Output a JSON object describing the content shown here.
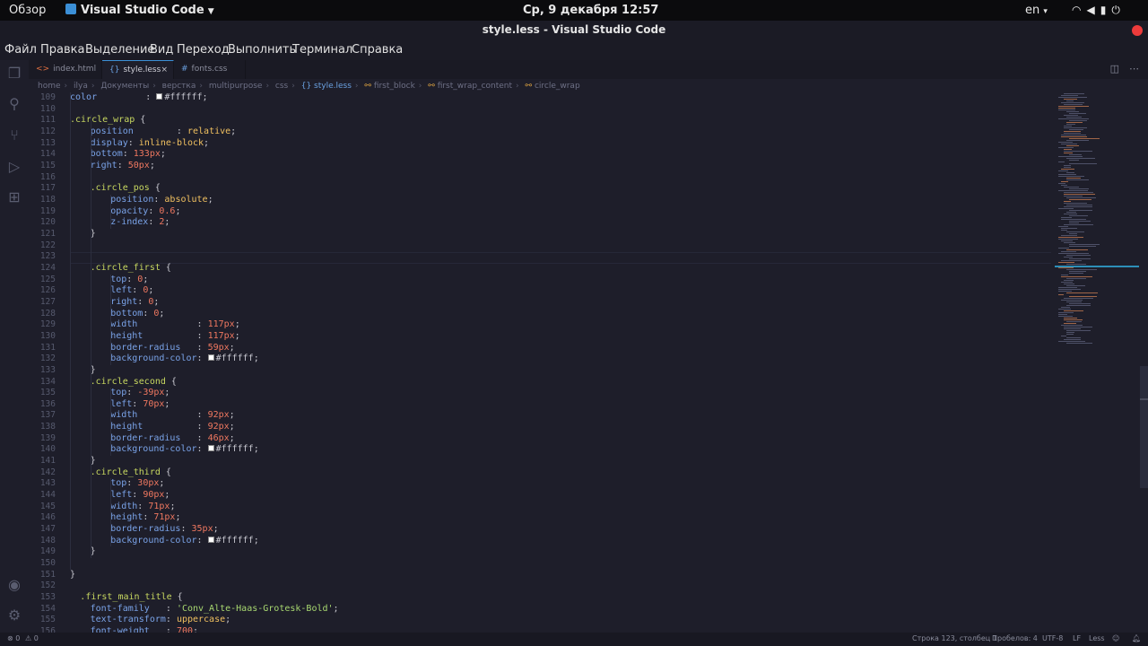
{
  "topbar": {
    "overview": "Обзор",
    "app_name": "Visual Studio Code",
    "clock": "Ср, 9 декабря  12:57",
    "keyboard_layout": "en",
    "system_icons": [
      "wifi-icon",
      "volume-icon",
      "battery-icon",
      "power-icon"
    ]
  },
  "window": {
    "title": "style.less - Visual Studio Code",
    "close_color": "#ed3b3b"
  },
  "menu": [
    "Файл",
    "Правка",
    "Выделение",
    "Вид",
    "Переход",
    "Выполнить",
    "Терминал",
    "Справка"
  ],
  "activity_icons": [
    "explorer-icon",
    "search-icon",
    "source-control-icon",
    "run-debug-icon",
    "extensions-icon",
    "account-icon",
    "settings-gear-icon"
  ],
  "tabs": [
    {
      "label": "index.html",
      "icon": "<>",
      "active": false
    },
    {
      "label": "style.less",
      "icon": "{}",
      "active": true,
      "close": "×"
    },
    {
      "label": "fonts.css",
      "icon": "#",
      "active": false
    }
  ],
  "breadcrumb": [
    "home",
    "ilya",
    "Документы",
    "верстка",
    "multipurpose",
    "css",
    "{} style.less",
    "first_block",
    "first_wrap_content",
    "circle_wrap"
  ],
  "editor": {
    "lines": [
      {
        "n": "109",
        "t": "color         : ",
        "indent": 2
      },
      {
        "n": "110",
        "t": "",
        "indent": 0
      },
      {
        "n": "111",
        "t": ".circle_wrap {",
        "indent": 2
      },
      {
        "n": "112",
        "t": "position        : relative;",
        "indent": 3
      },
      {
        "n": "113",
        "t": "display: inline-block;",
        "indent": 3
      },
      {
        "n": "114",
        "t": "bottom: 133px;",
        "indent": 3
      },
      {
        "n": "115",
        "t": "right: 50px;",
        "indent": 3
      },
      {
        "n": "116",
        "t": "",
        "indent": 0
      },
      {
        "n": "117",
        "t": ".circle_pos {",
        "indent": 3
      },
      {
        "n": "118",
        "t": "position: absolute;",
        "indent": 4
      },
      {
        "n": "119",
        "t": "opacity: 0.6;",
        "indent": 4
      },
      {
        "n": "120",
        "t": "z-index: 2;",
        "indent": 4
      },
      {
        "n": "121",
        "t": "}",
        "indent": 3
      },
      {
        "n": "122",
        "t": "",
        "indent": 0
      },
      {
        "n": "123",
        "t": "",
        "indent": 0
      },
      {
        "n": "124",
        "t": ".circle_first {",
        "indent": 3
      },
      {
        "n": "125",
        "t": "top: 0;",
        "indent": 4
      },
      {
        "n": "126",
        "t": "left: 0;",
        "indent": 4
      },
      {
        "n": "127",
        "t": "right: 0;",
        "indent": 4
      },
      {
        "n": "128",
        "t": "bottom: 0;",
        "indent": 4
      },
      {
        "n": "129",
        "t": "width           : 117px;",
        "indent": 4
      },
      {
        "n": "130",
        "t": "height          : 117px;",
        "indent": 4
      },
      {
        "n": "131",
        "t": "border-radius   : 59px;",
        "indent": 4
      },
      {
        "n": "132",
        "t": "background-color: ",
        "indent": 4
      },
      {
        "n": "133",
        "t": "}",
        "indent": 3
      },
      {
        "n": "134",
        "t": ".circle_second {",
        "indent": 3
      },
      {
        "n": "135",
        "t": "top: -39px;",
        "indent": 4
      },
      {
        "n": "136",
        "t": "left: 70px;",
        "indent": 4
      },
      {
        "n": "137",
        "t": "width           : 92px;",
        "indent": 4
      },
      {
        "n": "138",
        "t": "height          : 92px;",
        "indent": 4
      },
      {
        "n": "139",
        "t": "border-radius   : 46px;",
        "indent": 4
      },
      {
        "n": "140",
        "t": "background-color: ",
        "indent": 4
      },
      {
        "n": "141",
        "t": "}",
        "indent": 3
      },
      {
        "n": "142",
        "t": ".circle_third {",
        "indent": 3
      },
      {
        "n": "143",
        "t": "top: 30px;",
        "indent": 4
      },
      {
        "n": "144",
        "t": "left: 90px;",
        "indent": 4
      },
      {
        "n": "145",
        "t": "width: 71px;",
        "indent": 4
      },
      {
        "n": "146",
        "t": "height: 71px;",
        "indent": 4
      },
      {
        "n": "147",
        "t": "border-radius: 35px;",
        "indent": 4
      },
      {
        "n": "148",
        "t": "background-color: ",
        "indent": 4
      },
      {
        "n": "149",
        "t": "}",
        "indent": 3
      },
      {
        "n": "150",
        "t": "",
        "indent": 0
      },
      {
        "n": "151",
        "t": "}",
        "indent": 2
      },
      {
        "n": "152",
        "t": "",
        "indent": 0
      },
      {
        "n": "153",
        "t": ".first_main_title {",
        "indent": 2.5
      },
      {
        "n": "154",
        "t": "font-family   : 'Conv_Alte-Haas-Grotesk-Bold';",
        "indent": 3
      },
      {
        "n": "155",
        "t": "text-transform: uppercase;",
        "indent": 3
      },
      {
        "n": "156",
        "t": "font-weight   : 700;",
        "indent": 3
      }
    ],
    "color_value": "#ffffff;",
    "swatch_color": "#ffffff"
  },
  "statusbar": {
    "errors": "⊗ 0",
    "warnings": "⚠ 0",
    "position": "Строка 123, столбец 1",
    "spaces": "Пробелов: 4",
    "encoding": "UTF-8",
    "eol": "LF",
    "language": "Less"
  }
}
